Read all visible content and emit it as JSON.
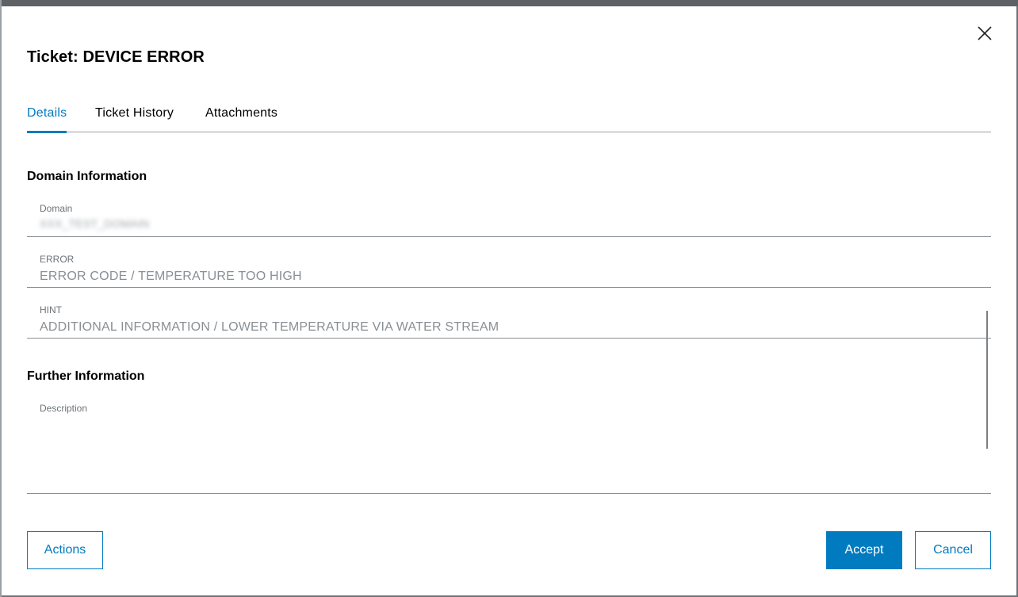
{
  "dialog": {
    "title": "Ticket: DEVICE ERROR",
    "close_icon": "close-icon"
  },
  "tabs": [
    {
      "label": "Details",
      "active": true
    },
    {
      "label": "Ticket History",
      "active": false
    },
    {
      "label": "Attachments",
      "active": false
    }
  ],
  "domain_information": {
    "heading": "Domain Information",
    "domain": {
      "label": "Domain",
      "value": "XXX_TEST_DOMAIN"
    },
    "error": {
      "label": "ERROR",
      "value": "ERROR CODE / TEMPERATURE TOO HIGH"
    },
    "hint": {
      "label": "HINT",
      "value": "ADDITIONAL INFORMATION / LOWER TEMPERATURE VIA WATER STREAM"
    }
  },
  "further_information": {
    "heading": "Further Information",
    "description": {
      "label": "Description",
      "value": ""
    }
  },
  "footer": {
    "actions_label": "Actions",
    "accept_label": "Accept",
    "cancel_label": "Cancel"
  },
  "colors": {
    "accent": "#007bc0",
    "text": "#000000",
    "muted": "#8a8f94"
  }
}
